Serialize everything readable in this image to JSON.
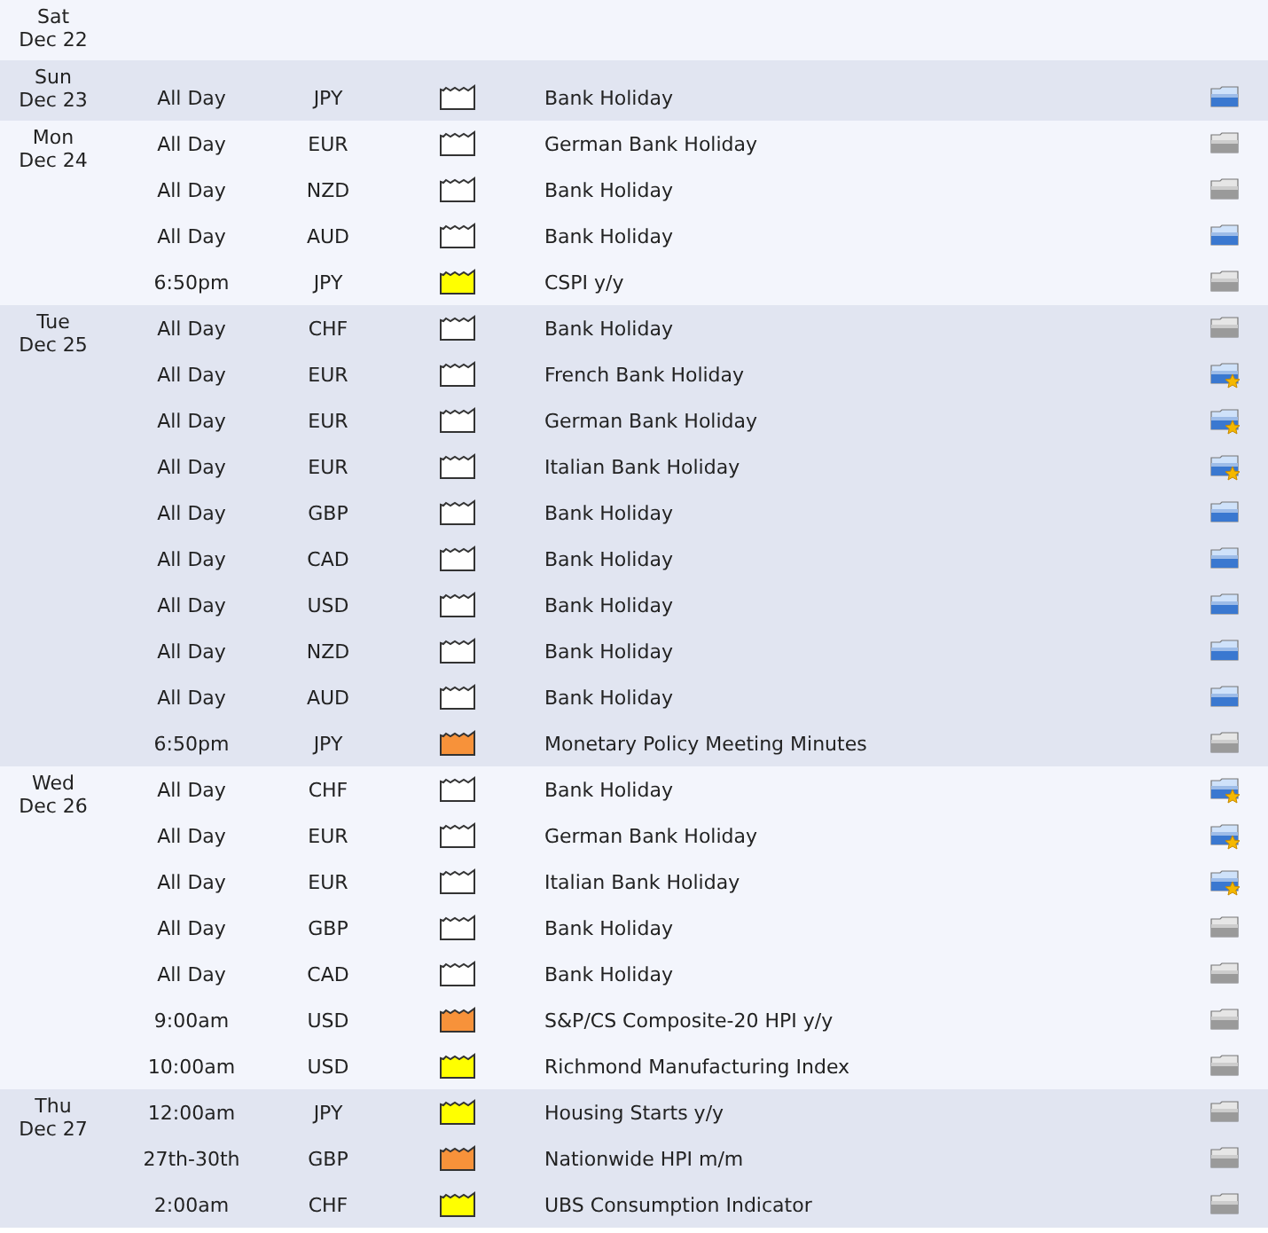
{
  "days": [
    {
      "weekday": "Sat",
      "date": "Dec 22"
    },
    {
      "weekday": "Sun",
      "date": "Dec 23",
      "events": [
        {
          "time": "All Day",
          "currency": "JPY",
          "impact": {
            "color": "#ffffff"
          },
          "title": "Bank Holiday",
          "folder": {
            "kind": "blue"
          }
        }
      ]
    },
    {
      "weekday": "Mon",
      "date": "Dec 24",
      "events": [
        {
          "time": "All Day",
          "currency": "EUR",
          "impact": {
            "color": "#ffffff"
          },
          "title": "German Bank Holiday",
          "folder": {
            "kind": "gray"
          }
        },
        {
          "time": "All Day",
          "currency": "NZD",
          "impact": {
            "color": "#ffffff"
          },
          "title": "Bank Holiday",
          "folder": {
            "kind": "gray"
          }
        },
        {
          "time": "All Day",
          "currency": "AUD",
          "impact": {
            "color": "#ffffff"
          },
          "title": "Bank Holiday",
          "folder": {
            "kind": "blue"
          }
        },
        {
          "time": "6:50pm",
          "currency": "JPY",
          "impact": {
            "color": "#ffff00"
          },
          "title": "CSPI y/y",
          "folder": {
            "kind": "gray"
          }
        }
      ]
    },
    {
      "weekday": "Tue",
      "date": "Dec 25",
      "events": [
        {
          "time": "All Day",
          "currency": "CHF",
          "impact": {
            "color": "#ffffff"
          },
          "title": "Bank Holiday",
          "folder": {
            "kind": "gray"
          }
        },
        {
          "time": "All Day",
          "currency": "EUR",
          "impact": {
            "color": "#ffffff"
          },
          "title": "French Bank Holiday",
          "folder": {
            "kind": "starred"
          }
        },
        {
          "time": "All Day",
          "currency": "EUR",
          "impact": {
            "color": "#ffffff"
          },
          "title": "German Bank Holiday",
          "folder": {
            "kind": "starred"
          }
        },
        {
          "time": "All Day",
          "currency": "EUR",
          "impact": {
            "color": "#ffffff"
          },
          "title": "Italian Bank Holiday",
          "folder": {
            "kind": "starred"
          }
        },
        {
          "time": "All Day",
          "currency": "GBP",
          "impact": {
            "color": "#ffffff"
          },
          "title": "Bank Holiday",
          "folder": {
            "kind": "blue"
          }
        },
        {
          "time": "All Day",
          "currency": "CAD",
          "impact": {
            "color": "#ffffff"
          },
          "title": "Bank Holiday",
          "folder": {
            "kind": "blue"
          }
        },
        {
          "time": "All Day",
          "currency": "USD",
          "impact": {
            "color": "#ffffff"
          },
          "title": "Bank Holiday",
          "folder": {
            "kind": "blue"
          }
        },
        {
          "time": "All Day",
          "currency": "NZD",
          "impact": {
            "color": "#ffffff"
          },
          "title": "Bank Holiday",
          "folder": {
            "kind": "blue"
          }
        },
        {
          "time": "All Day",
          "currency": "AUD",
          "impact": {
            "color": "#ffffff"
          },
          "title": "Bank Holiday",
          "folder": {
            "kind": "blue"
          }
        },
        {
          "time": "6:50pm",
          "currency": "JPY",
          "impact": {
            "color": "#f7923a"
          },
          "title": "Monetary Policy Meeting Minutes",
          "folder": {
            "kind": "gray"
          }
        }
      ]
    },
    {
      "weekday": "Wed",
      "date": "Dec 26",
      "events": [
        {
          "time": "All Day",
          "currency": "CHF",
          "impact": {
            "color": "#ffffff"
          },
          "title": "Bank Holiday",
          "folder": {
            "kind": "starred"
          }
        },
        {
          "time": "All Day",
          "currency": "EUR",
          "impact": {
            "color": "#ffffff"
          },
          "title": "German Bank Holiday",
          "folder": {
            "kind": "starred"
          }
        },
        {
          "time": "All Day",
          "currency": "EUR",
          "impact": {
            "color": "#ffffff"
          },
          "title": "Italian Bank Holiday",
          "folder": {
            "kind": "starred"
          }
        },
        {
          "time": "All Day",
          "currency": "GBP",
          "impact": {
            "color": "#ffffff"
          },
          "title": "Bank Holiday",
          "folder": {
            "kind": "gray"
          }
        },
        {
          "time": "All Day",
          "currency": "CAD",
          "impact": {
            "color": "#ffffff"
          },
          "title": "Bank Holiday",
          "folder": {
            "kind": "gray"
          }
        },
        {
          "time": "9:00am",
          "currency": "USD",
          "impact": {
            "color": "#f7923a"
          },
          "title": "S&P/CS Composite-20 HPI y/y",
          "folder": {
            "kind": "gray"
          }
        },
        {
          "time": "10:00am",
          "currency": "USD",
          "impact": {
            "color": "#ffff00"
          },
          "title": "Richmond Manufacturing Index",
          "folder": {
            "kind": "gray"
          }
        }
      ]
    },
    {
      "weekday": "Thu",
      "date": "Dec 27",
      "events": [
        {
          "time": "12:00am",
          "currency": "JPY",
          "impact": {
            "color": "#ffff00"
          },
          "title": "Housing Starts y/y",
          "folder": {
            "kind": "gray"
          }
        },
        {
          "time": "27th-30th",
          "currency": "GBP",
          "impact": {
            "color": "#f7923a"
          },
          "title": "Nationwide HPI m/m",
          "folder": {
            "kind": "gray"
          }
        },
        {
          "time": "2:00am",
          "currency": "CHF",
          "impact": {
            "color": "#ffff00"
          },
          "title": "UBS Consumption Indicator",
          "folder": {
            "kind": "gray"
          }
        }
      ]
    }
  ]
}
